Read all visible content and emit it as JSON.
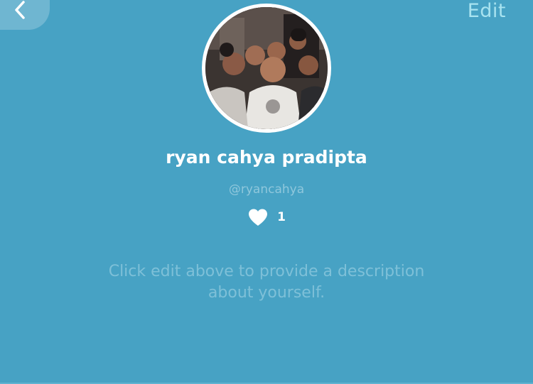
{
  "header": {
    "back_icon": "chevron-left-icon",
    "edit_label": "Edit"
  },
  "profile": {
    "avatar_alt": "profile photo",
    "display_name": "ryan cahya pradipta",
    "username": "@ryancahya",
    "like_icon": "heart-icon",
    "like_count": "1",
    "description_placeholder_line1": "Click edit above to provide a description",
    "description_placeholder_line2": "about yourself."
  },
  "colors": {
    "background": "#47a2c4",
    "edit_text": "#a8e3f0",
    "muted_text": "#7ec0d8",
    "white": "#ffffff"
  }
}
